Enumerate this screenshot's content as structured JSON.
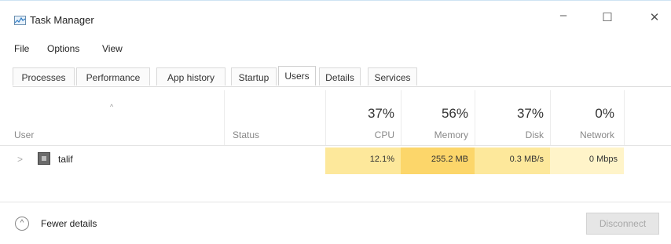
{
  "window": {
    "title": "Task Manager",
    "controls": {
      "minimize": "–",
      "maximize": "☐",
      "close": "✕"
    }
  },
  "menu": [
    "File",
    "Options",
    "View"
  ],
  "tabs": [
    {
      "label": "Processes",
      "active": false
    },
    {
      "label": "Performance",
      "active": false
    },
    {
      "label": "App history",
      "active": false
    },
    {
      "label": "Startup",
      "active": false
    },
    {
      "label": "Users",
      "active": true
    },
    {
      "label": "Details",
      "active": false
    },
    {
      "label": "Services",
      "active": false
    }
  ],
  "table": {
    "sort_caret": "^",
    "columns": {
      "user": "User",
      "status": "Status",
      "cpu": {
        "percent": "37%",
        "label": "CPU"
      },
      "memory": {
        "percent": "56%",
        "label": "Memory"
      },
      "disk": {
        "percent": "37%",
        "label": "Disk"
      },
      "network": {
        "percent": "0%",
        "label": "Network"
      }
    },
    "rows": [
      {
        "expand": ">",
        "user": "talif",
        "status": "",
        "cpu": "12.1%",
        "memory": "255.2 MB",
        "disk": "0.3 MB/s",
        "network": "0 Mbps"
      }
    ]
  },
  "footer": {
    "fewer_details": "Fewer details",
    "fewer_icon": "^",
    "disconnect": "Disconnect"
  },
  "colors": {
    "cpu_cell": "#fde89b",
    "memory_cell": "#fcd66a",
    "disk_cell": "#fde89b",
    "network_cell": "#fff4c9"
  },
  "icons": {
    "app": "task-manager-icon",
    "user": "user-icon",
    "expand": "chevron-right-icon",
    "fewer": "chevron-up-circle-icon"
  }
}
